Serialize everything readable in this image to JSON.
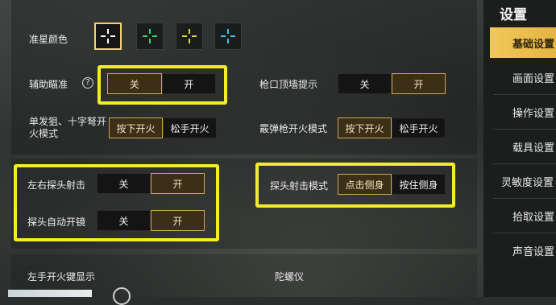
{
  "colors": {
    "accent": "#cfa852",
    "highlight": "#f3ec2a",
    "sidebar_active": "#e5b443"
  },
  "crosshair": {
    "label": "准星颜色",
    "options": [
      {
        "color": "#ffffff",
        "icon": "crosshair-white-icon",
        "selected": true
      },
      {
        "color": "#39d46a",
        "icon": "crosshair-green-icon",
        "selected": false
      },
      {
        "color": "#e2d23a",
        "icon": "crosshair-yellow-icon",
        "selected": false
      },
      {
        "color": "#35c8e8",
        "icon": "crosshair-cyan-icon",
        "selected": false
      }
    ]
  },
  "aim_assist": {
    "label": "辅助瞄准",
    "help": "?",
    "off": "关",
    "on": "开",
    "value": "关"
  },
  "muzzle_wall": {
    "label": "枪口顶墙提示",
    "off": "关",
    "on": "开",
    "value": "开"
  },
  "single_shot": {
    "label": "单发狙、十字弩开火模式",
    "press": "按下开火",
    "release": "松手开火",
    "value": "按下开火"
  },
  "shotgun": {
    "label": "霰弹枪开火模式",
    "press": "按下开火",
    "release": "松手开火",
    "value": "按下开火"
  },
  "peek_fire": {
    "label": "左右探头射击",
    "off": "关",
    "on": "开",
    "value": "开"
  },
  "peek_scope": {
    "label": "探头自动开镜",
    "off": "关",
    "on": "开",
    "value": "开"
  },
  "peek_mode": {
    "label": "探头射击模式",
    "tap": "点击侧身",
    "hold": "按住侧身",
    "value": "点击侧身"
  },
  "left_fire": {
    "label": "左手开火键显示"
  },
  "gyro": {
    "label": "陀螺仪"
  },
  "sidebar": {
    "title": "设置",
    "items": [
      "基础设置",
      "画面设置",
      "操作设置",
      "载具设置",
      "灵敏度设置",
      "拾取设置",
      "声音设置"
    ],
    "active": 0
  }
}
